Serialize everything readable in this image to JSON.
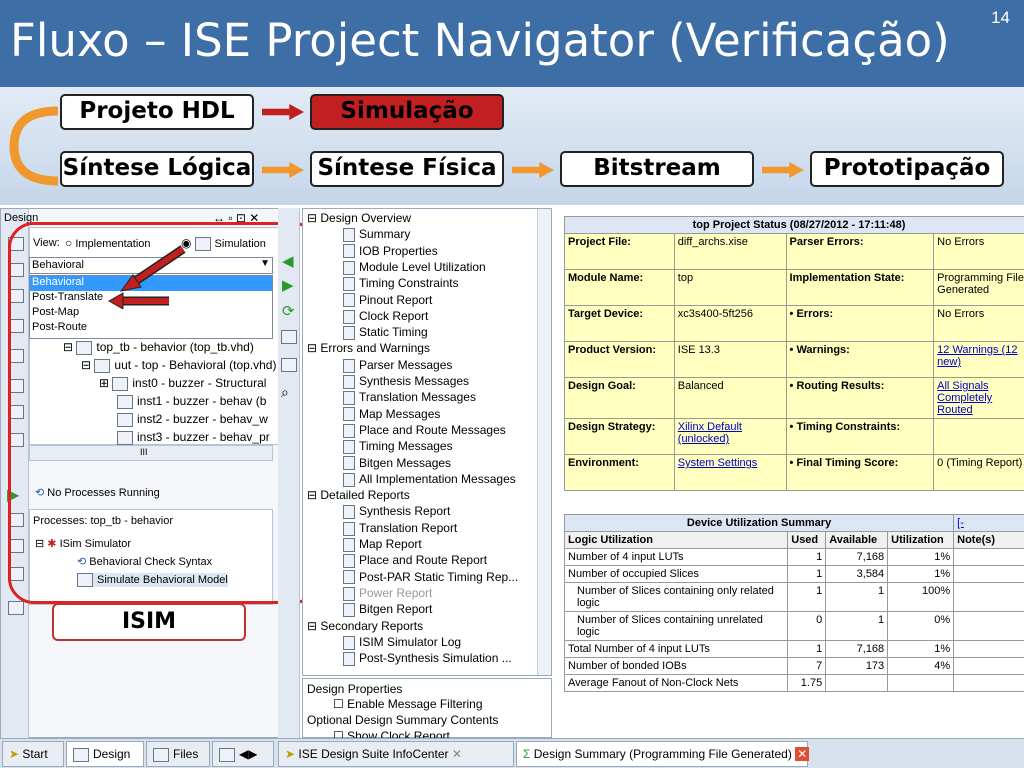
{
  "slide": {
    "title": "Fluxo – ISE Project Navigator (Verificação)",
    "page": "14"
  },
  "flow": {
    "b1": "Projeto HDL",
    "b2": "Simulação",
    "b3": "Síntese Lógica",
    "b4": "Síntese Física",
    "b5": "Bitstream",
    "b6": "Prototipação",
    "isim": "ISIM"
  },
  "design": {
    "header": "Design",
    "view_label": "View:",
    "impl": "Implementation",
    "sim": "Simulation",
    "select": "Behavioral",
    "options": [
      "Behavioral",
      "Post-Translate",
      "Post-Map",
      "Post-Route"
    ],
    "tree": [
      "top_tb - behavior (top_tb.vhd)",
      "uut - top - Behavioral (top.vhd)",
      "inst0 - buzzer - Structural",
      "inst1 - buzzer - behav (b",
      "inst2 - buzzer - behav_w",
      "inst3 - buzzer - behav_pr"
    ],
    "scroll_mark": "III",
    "no_proc": "No Processes Running",
    "processes_hdr": "Processes: top_tb - behavior",
    "isim_sim": "ISim Simulator",
    "check": "Behavioral Check Syntax",
    "simulate": "Simulate Behavioral Model"
  },
  "nav": [
    {
      "t": "Design Overview",
      "l": 0
    },
    {
      "t": "Summary",
      "l": 1
    },
    {
      "t": "IOB Properties",
      "l": 1
    },
    {
      "t": "Module Level Utilization",
      "l": 1
    },
    {
      "t": "Timing Constraints",
      "l": 1
    },
    {
      "t": "Pinout Report",
      "l": 1
    },
    {
      "t": "Clock Report",
      "l": 1
    },
    {
      "t": "Static Timing",
      "l": 1
    },
    {
      "t": "Errors and Warnings",
      "l": 0
    },
    {
      "t": "Parser Messages",
      "l": 1
    },
    {
      "t": "Synthesis Messages",
      "l": 1
    },
    {
      "t": "Translation Messages",
      "l": 1
    },
    {
      "t": "Map Messages",
      "l": 1
    },
    {
      "t": "Place and Route Messages",
      "l": 1
    },
    {
      "t": "Timing Messages",
      "l": 1
    },
    {
      "t": "Bitgen Messages",
      "l": 1
    },
    {
      "t": "All Implementation Messages",
      "l": 1
    },
    {
      "t": "Detailed Reports",
      "l": 0
    },
    {
      "t": "Synthesis Report",
      "l": 1
    },
    {
      "t": "Translation Report",
      "l": 1
    },
    {
      "t": "Map Report",
      "l": 1
    },
    {
      "t": "Place and Route Report",
      "l": 1
    },
    {
      "t": "Post-PAR Static Timing Rep...",
      "l": 1
    },
    {
      "t": "Power Report",
      "l": 1,
      "dim": true
    },
    {
      "t": "Bitgen Report",
      "l": 1
    },
    {
      "t": "Secondary Reports",
      "l": 0
    },
    {
      "t": "ISIM Simulator Log",
      "l": 1
    },
    {
      "t": "Post-Synthesis Simulation ...",
      "l": 1
    }
  ],
  "props": {
    "hdr": "Design Properties",
    "p1": "Enable Message Filtering",
    "p2": "Optional Design Summary Contents",
    "p3": "Show Clock Report"
  },
  "status": {
    "title": "top Project Status (08/27/2012 - 17:11:48)",
    "rows": [
      [
        "Project File:",
        "diff_archs.xise",
        "Parser Errors:",
        "No Errors"
      ],
      [
        "Module Name:",
        "top",
        "Implementation State:",
        "Programming File Generated"
      ],
      [
        "Target Device:",
        "xc3s400-5ft256",
        "• Errors:",
        "No Errors"
      ],
      [
        "Product Version:",
        "ISE 13.3",
        "• Warnings:",
        "12 Warnings (12 new)"
      ],
      [
        "Design Goal:",
        "Balanced",
        "• Routing Results:",
        "All Signals Completely Routed"
      ],
      [
        "Design Strategy:",
        "Xilinx Default (unlocked)",
        "• Timing Constraints:",
        ""
      ],
      [
        "Environment:",
        "System Settings",
        "• Final Timing Score:",
        "0  (Timing Report)"
      ]
    ]
  },
  "util": {
    "title": "Device Utilization Summary",
    "link": "[-",
    "headers": [
      "Logic Utilization",
      "Used",
      "Available",
      "Utilization",
      "Note(s)"
    ],
    "rows": [
      [
        "Number of 4 input LUTs",
        "1",
        "7,168",
        "1%",
        ""
      ],
      [
        "Number of occupied Slices",
        "1",
        "3,584",
        "1%",
        ""
      ],
      [
        "Number of Slices containing only related logic",
        "1",
        "1",
        "100%",
        ""
      ],
      [
        "Number of Slices containing unrelated logic",
        "0",
        "1",
        "0%",
        ""
      ],
      [
        "Total Number of 4 input LUTs",
        "1",
        "7,168",
        "1%",
        ""
      ],
      [
        "Number of bonded IOBs",
        "7",
        "173",
        "4%",
        ""
      ],
      [
        "Average Fanout of Non-Clock Nets",
        "1.75",
        "",
        "",
        ""
      ]
    ]
  },
  "tabs": {
    "start": "Start",
    "design": "Design",
    "files": "Files",
    "infocenter": "ISE Design Suite InfoCenter",
    "summary": "Design Summary (Programming File Generated)"
  },
  "colors": {
    "header": "#3d6ea6",
    "accent": "#f0972d",
    "red": "#c22020",
    "yellow": "#ffffc0"
  }
}
